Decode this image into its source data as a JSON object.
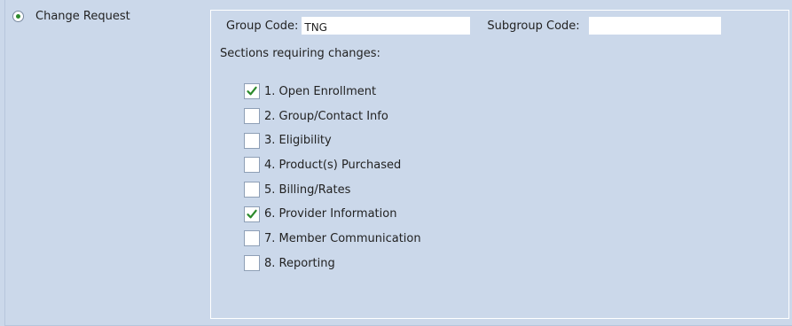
{
  "request": {
    "radio_label": "Change Request",
    "radio_selected": true
  },
  "fields": {
    "group_code_label": "Group Code:",
    "group_code_value": "TNG",
    "subgroup_code_label": "Subgroup Code:",
    "subgroup_code_value": ""
  },
  "sections": {
    "heading": "Sections requiring changes:",
    "items": [
      {
        "label": "1. Open Enrollment",
        "checked": true
      },
      {
        "label": "2. Group/Contact Info",
        "checked": false
      },
      {
        "label": "3. Eligibility",
        "checked": false
      },
      {
        "label": "4. Product(s) Purchased",
        "checked": false
      },
      {
        "label": "5. Billing/Rates",
        "checked": false
      },
      {
        "label": "6. Provider Information",
        "checked": true
      },
      {
        "label": "7. Member Communication",
        "checked": false
      },
      {
        "label": "8. Reporting",
        "checked": false
      }
    ]
  },
  "colors": {
    "background": "#cbd8ea",
    "checkmark": "#2c8a2c",
    "radio_dot": "#2c8a2c"
  }
}
